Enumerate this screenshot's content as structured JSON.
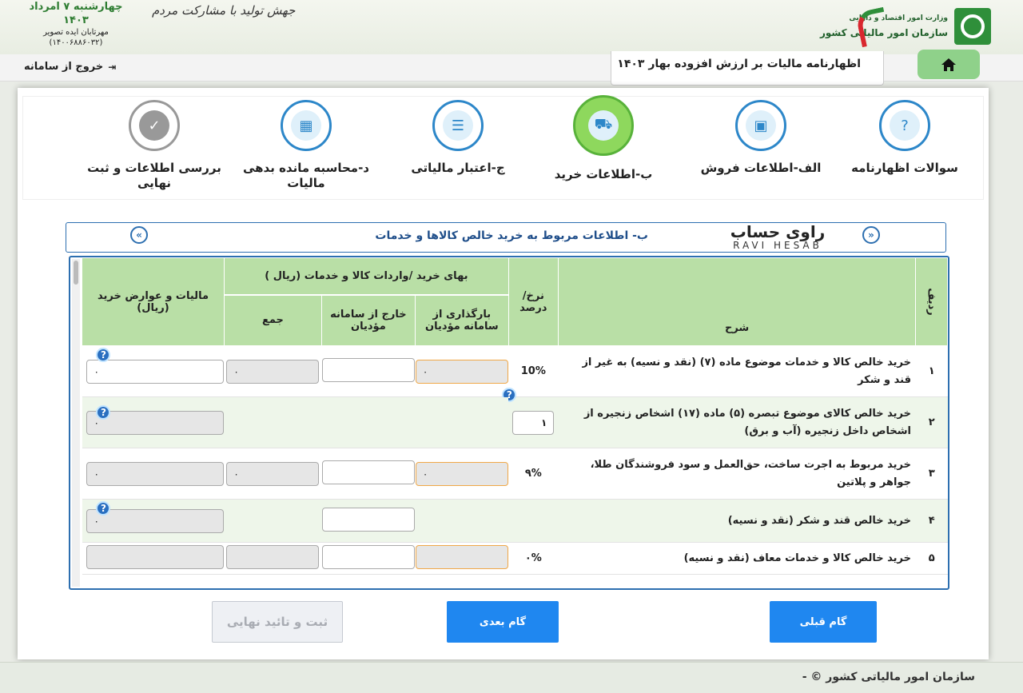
{
  "header": {
    "logo_line1": "وزارت امور اقتصاد و دارایی",
    "logo_line2": "سازمان امور مالیاتی کشور",
    "slogan": "جهش تولید با مشارکت مردم",
    "date_line1": "چهارشنبه ۷ امرداد",
    "date_line2": "۱۴۰۳",
    "company": "مهرتابان ایده تصویر",
    "tracking": "(۱۴۰۰۶۸۸۶۰۳۲)"
  },
  "nav": {
    "exit_label": "خروج از سامانه",
    "form_title": "اظهارنامه مالیات بر ارزش افزوده بهار ۱۴۰۳"
  },
  "steps": [
    {
      "label": "سوالات اظهارنامه",
      "icon": "question-icon"
    },
    {
      "label": "الف-اطلاعات فروش",
      "icon": "shopping-bag-icon"
    },
    {
      "label": "ب-اطلاعات خرید",
      "icon": "cart-icon",
      "active": true
    },
    {
      "label": "ج-اعتبار مالیاتی",
      "icon": "list-icon"
    },
    {
      "label": "د-محاسبه مانده بدهی مالیات",
      "icon": "calculator-icon"
    },
    {
      "label": "بررسی اطلاعات و ثبت نهایی",
      "icon": "check-badge-icon"
    }
  ],
  "section": {
    "title": "ب- اطلاعات مربوط به خرید خالص کالاها و خدمات",
    "watermark_fa": "راوی حساب",
    "watermark_en": "RAVI HESAB"
  },
  "table": {
    "headers": {
      "row": "ردیف",
      "desc": "شرح",
      "rate": "نرخ/ درصد",
      "group": "بهای خرید /واردات کالا و خدمات (ریال )",
      "registered": "بارگذاری از سامانه مؤدیان",
      "outside": "خارج از سامانه مؤدیان",
      "sum": "جمع",
      "tax": "مالیات و عوارض خرید (ریال)"
    },
    "rows": [
      {
        "num": "۱",
        "desc": "خرید خالص کالا و خدمات موضوع ماده (۷) (نقد و نسیه) به غیر از قند و شکر",
        "rate": "10%",
        "registered": "۰",
        "outside": "",
        "sum": "۰",
        "tax": "۰"
      },
      {
        "num": "۲",
        "desc": "خرید خالص کالای موضوع تبصره (۵) ماده (۱۷) اشخاص زنجیره از اشخاص داخل زنجیره (آب و برق)",
        "rate": "۱",
        "registered": "",
        "outside": "",
        "sum": "",
        "tax": "۰"
      },
      {
        "num": "۳",
        "desc": "خرید مربوط به اجرت ساخت، حق‌العمل و سود فروشندگان طلا، جواهر و پلاتین",
        "rate": "۹%",
        "registered": "۰",
        "outside": "",
        "sum": "۰",
        "tax": "۰"
      },
      {
        "num": "۴",
        "desc": "خرید خالص قند و شکر (نقد و نسیه)",
        "rate": "",
        "registered": "",
        "outside": "",
        "sum": "",
        "tax": "۰"
      },
      {
        "num": "۵",
        "desc": "خرید خالص کالا و خدمات معاف (نقد و نسیه)",
        "rate": "۰%",
        "registered": "",
        "outside": "",
        "sum": "",
        "tax": ""
      }
    ]
  },
  "buttons": {
    "final": "ثبت  و تائید نهایی",
    "next": "گام بعدی",
    "prev": "گام قبلی"
  },
  "footer": {
    "text": "سازمان امور مالیاتی کشور © -"
  },
  "colors": {
    "accent": "#1f87f0",
    "header_green": "#b9dfa6",
    "active_step": "#8ed85d",
    "border_blue": "#2d6fb0"
  }
}
